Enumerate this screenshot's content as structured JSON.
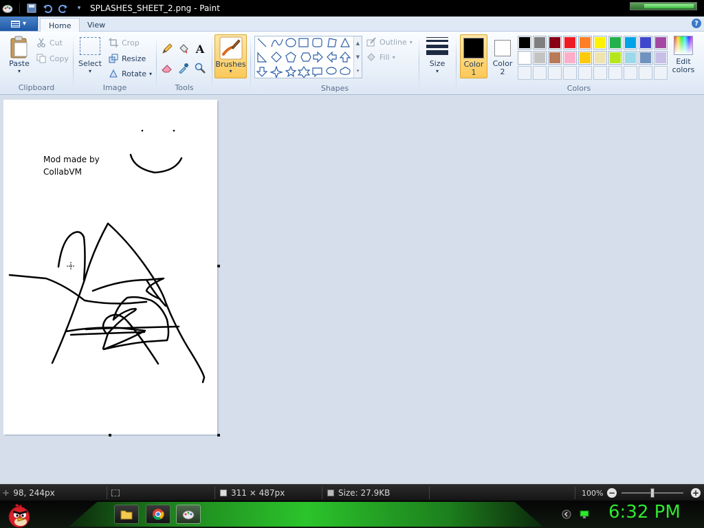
{
  "window": {
    "title": "SPLASHES_SHEET_2.png - Paint"
  },
  "tabs": [
    {
      "label": "Home"
    },
    {
      "label": "View"
    }
  ],
  "help_label": "?",
  "ribbon": {
    "clipboard": {
      "group_label": "Clipboard",
      "paste": "Paste",
      "cut": "Cut",
      "copy": "Copy"
    },
    "image": {
      "group_label": "Image",
      "select": "Select",
      "crop": "Crop",
      "resize": "Resize",
      "rotate": "Rotate"
    },
    "tools": {
      "group_label": "Tools",
      "text_tool": "A"
    },
    "brushes": {
      "label": "Brushes"
    },
    "shapes": {
      "group_label": "Shapes",
      "outline": "Outline",
      "fill": "Fill"
    },
    "size": {
      "label": "Size"
    },
    "colors": {
      "group_label": "Colors",
      "color1_line1": "Color",
      "color1_line2": "1",
      "color2_line1": "Color",
      "color2_line2": "2",
      "edit_line1": "Edit",
      "edit_line2": "colors",
      "color1": "#000000",
      "color2": "#ffffff",
      "palette_row1": [
        "#000000",
        "#7f7f7f",
        "#880015",
        "#ed1c24",
        "#ff7f27",
        "#fff200",
        "#22b14c",
        "#00a2e8",
        "#3f48cc",
        "#a349a4"
      ],
      "palette_row2": [
        "#ffffff",
        "#c3c3c3",
        "#b97a57",
        "#ffaec9",
        "#ffc90e",
        "#efe4b0",
        "#b5e61d",
        "#99d9ea",
        "#7092be",
        "#c8bfe7"
      ]
    }
  },
  "canvas": {
    "text_line1": "Mod made by",
    "text_line2": "CollabVM"
  },
  "status": {
    "cursor_pos": "98, 244px",
    "dimensions": "311 × 487px",
    "size": "Size: 27.9KB",
    "zoom": "100%"
  },
  "taskbar": {
    "clock": "6:32 PM"
  }
}
